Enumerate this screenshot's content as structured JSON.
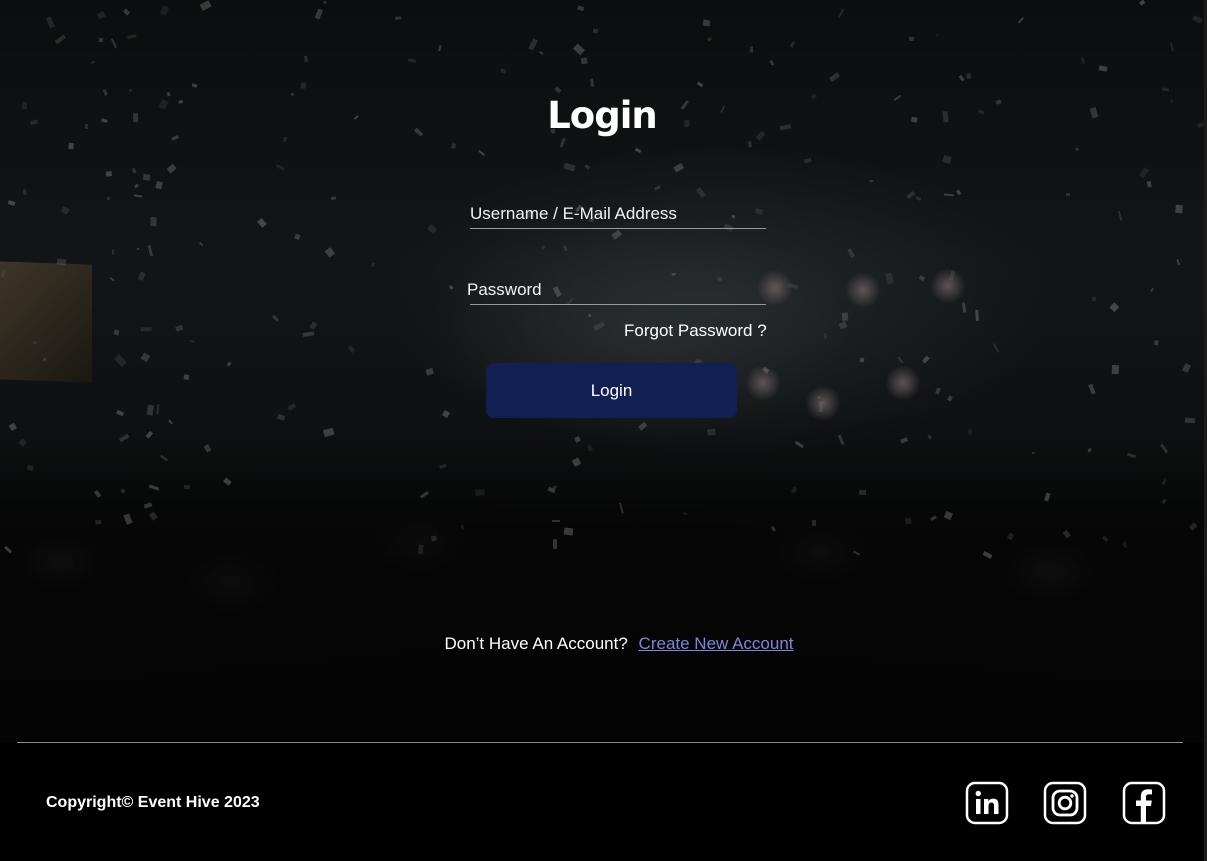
{
  "login": {
    "title": "Login",
    "username_placeholder": "Username / E-Mail Address",
    "password_placeholder": "Password",
    "forgot_password": "Forgot Password ?",
    "button_label": "Login"
  },
  "signup": {
    "prompt": "Don’t Have An Account?",
    "link_label": "Create New Account"
  },
  "footer": {
    "copyright": "Copyright© Event Hive 2023",
    "social": [
      {
        "name": "linkedin",
        "icon": "linkedin-icon"
      },
      {
        "name": "instagram",
        "icon": "instagram-icon"
      },
      {
        "name": "facebook",
        "icon": "facebook-icon"
      }
    ]
  },
  "colors": {
    "button_bg": "#121f52",
    "link": "#7b88d8",
    "background": "#000000"
  }
}
